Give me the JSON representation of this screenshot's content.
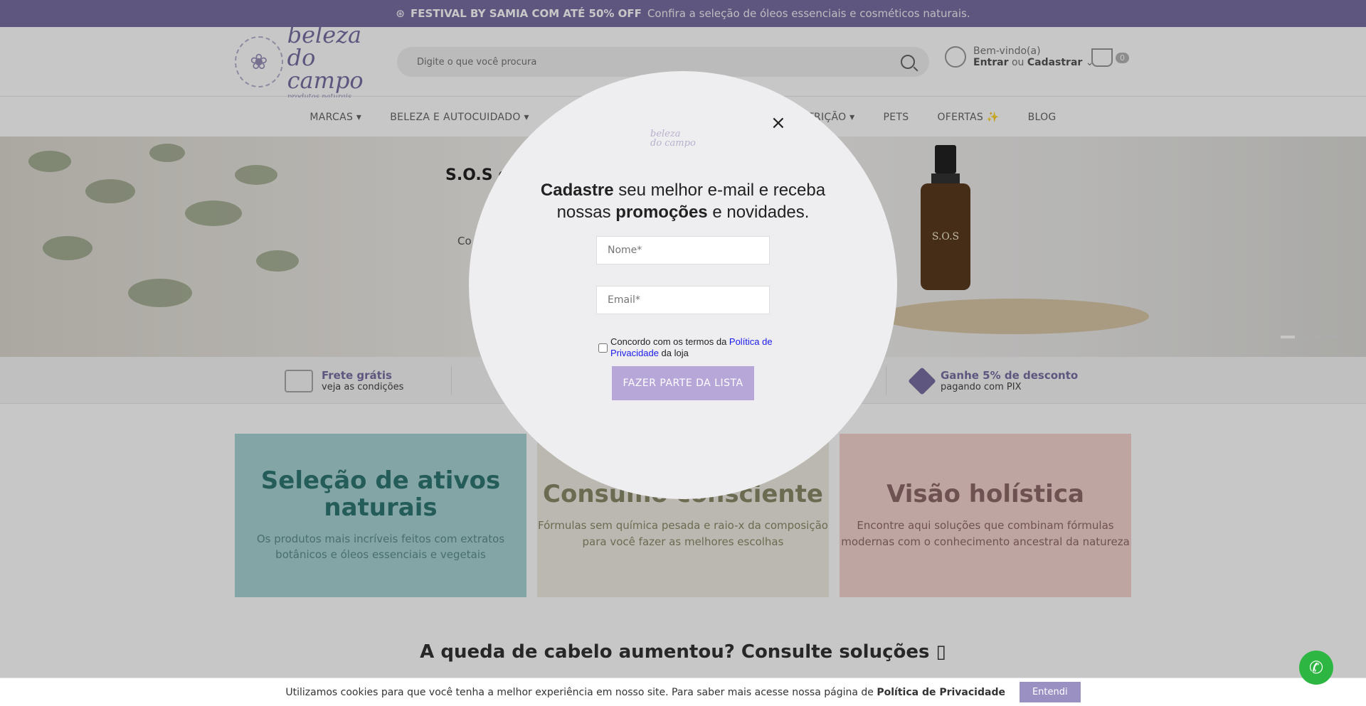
{
  "topbar": {
    "bold": "FESTIVAL BY SAMIA COM ATÉ 50% OFF",
    "text": "Confira a seleção de óleos essenciais e cosméticos naturais."
  },
  "header": {
    "logo_line1": "beleza",
    "logo_line2": "do campo",
    "logo_sub": "produtos naturais",
    "search_placeholder": "Digite o que você procura",
    "welcome": "Bem-vindo(a)",
    "login": "Entrar",
    "or": "ou",
    "register": "Cadastrar",
    "cart_count": "0"
  },
  "nav": [
    "MARCAS ▾",
    "BELEZA E AUTOCUIDADO ▾",
    "NUTRIÇÃO ▾",
    "PETS",
    "OFERTAS ✨",
    "BLOG"
  ],
  "hero": {
    "title": "S.O.S d",
    "p": "Co",
    "bottle_label": "S.O.S"
  },
  "benefits": [
    {
      "title": "Frete grátis",
      "sub": "veja as condições"
    },
    {
      "title": "Ganhe 5% de desconto",
      "sub": "pagando com PIX"
    }
  ],
  "banners": [
    {
      "title": "Seleção de ativos naturais",
      "text": "Os produtos mais incríveis feitos com extratos botânicos e óleos essenciais e vegetais"
    },
    {
      "title": "Consumo consciente",
      "text": "Fórmulas sem química pesada e raio-x da composição para você fazer as melhores escolhas"
    },
    {
      "title": "Visão holística",
      "text": "Encontre aqui soluções que combinam fórmulas modernas com o conhecimento ancestral da natureza"
    }
  ],
  "section_title": "A queda de cabelo aumentou? Consulte soluções ▯",
  "modal": {
    "close": "×",
    "logo_line1": "beleza",
    "logo_line2": "do campo",
    "head_bold1": "Cadastre",
    "head_text1": " seu melhor e-mail e receba",
    "head_text2": "nossas ",
    "head_bold2": "promoções",
    "head_text3": " e novidades.",
    "name_placeholder": "Nome*",
    "email_placeholder": "Email*",
    "consent_text": "Concordo com os termos da ",
    "consent_link": "Política de Privacidade",
    "consent_tail": " da loja",
    "button": "FAZER PARTE DA LISTA"
  },
  "cookie": {
    "text": "Utilizamos cookies para que você tenha a melhor experiência em nosso site. Para saber mais acesse nossa página de ",
    "link": "Política de Privacidade",
    "button": "Entendi"
  },
  "whatsapp": {
    "icon": "whatsapp-icon"
  }
}
